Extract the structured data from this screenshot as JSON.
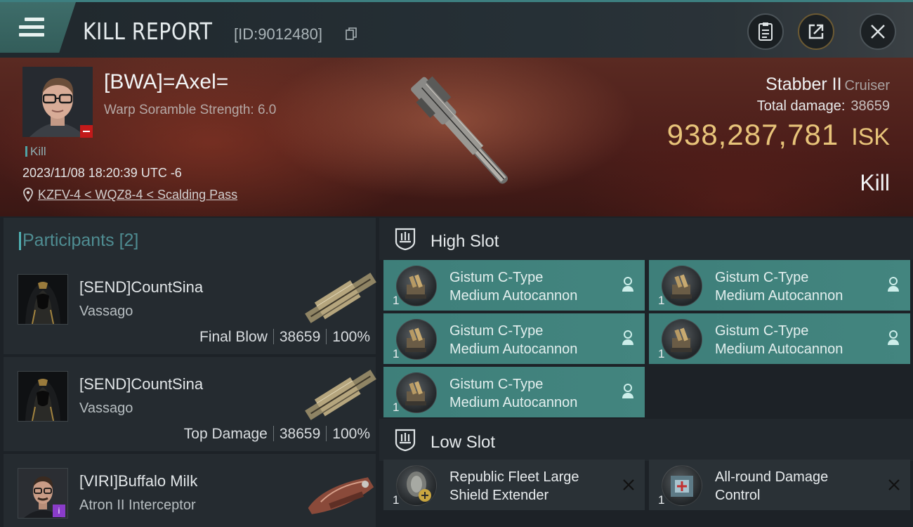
{
  "header": {
    "title": "KILL REPORT",
    "report_id": "[ID:9012480]"
  },
  "victim": {
    "pilot_name": "[BWA]=Axel=",
    "scramble": "Warp Soramble Strength: 6.0",
    "kill_tag": "Kill",
    "datetime": "2023/11/08 18:20:39 UTC -6",
    "location": "KZFV-4 < WQZ8-4 < Scalding Pass",
    "ship_name": "Stabber II",
    "ship_class": "Cruiser",
    "damage_label": "Total damage:",
    "damage_value": "38659",
    "isk_value": "938,287,781",
    "isk_unit": "ISK",
    "result_label": "Kill"
  },
  "participants": {
    "title": "Participants",
    "count": "[2]",
    "rows": [
      {
        "name": "[SEND]CountSina",
        "ship": "Vassago",
        "role": "Final Blow",
        "damage": "38659",
        "percent": "100%"
      },
      {
        "name": "[SEND]CountSina",
        "ship": "Vassago",
        "role": "Top Damage",
        "damage": "38659",
        "percent": "100%"
      },
      {
        "name": "[VIRI]Buffalo Milk",
        "ship": "Atron II Interceptor",
        "badge": "i"
      }
    ]
  },
  "slots": {
    "high": {
      "title": "High Slot",
      "modules": [
        {
          "qty": "1",
          "line1": "Gistum C-Type",
          "line2": "Medium Autocannon"
        },
        {
          "qty": "1",
          "line1": "Gistum C-Type",
          "line2": "Medium Autocannon"
        },
        {
          "qty": "1",
          "line1": "Gistum C-Type",
          "line2": "Medium Autocannon"
        },
        {
          "qty": "1",
          "line1": "Gistum C-Type",
          "line2": "Medium Autocannon"
        },
        {
          "qty": "1",
          "line1": "Gistum C-Type",
          "line2": "Medium Autocannon"
        }
      ]
    },
    "low": {
      "title": "Low Slot",
      "modules": [
        {
          "qty": "1",
          "line1": "Republic Fleet Large",
          "line2": "Shield Extender"
        },
        {
          "qty": "1",
          "line1": "All-round Damage",
          "line2": "Control"
        }
      ]
    }
  },
  "colors": {
    "accent_teal": "#3e7f7a",
    "isk_gold": "#e8c47a",
    "banner_red": "#4c1e1a"
  }
}
